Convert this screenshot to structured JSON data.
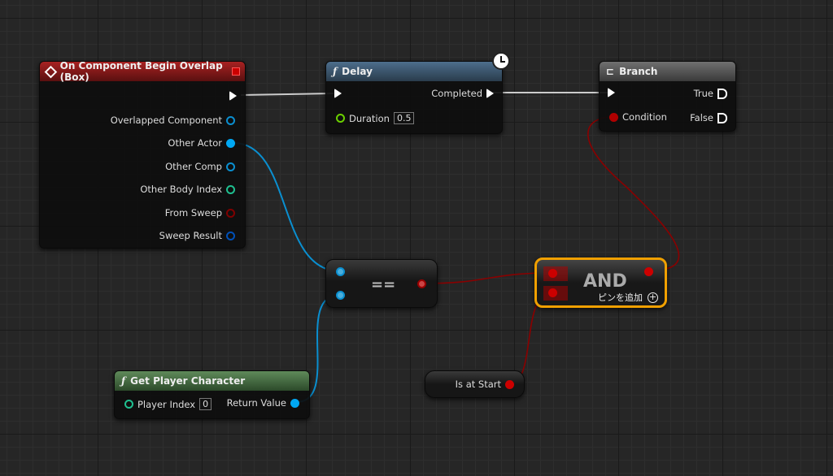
{
  "colors": {
    "event_header": "#8b1a1a",
    "function_header": "#3b5770",
    "branch_header": "#5a5a5a",
    "pure_header": "#4a7048",
    "object_pin": "#00a8f4",
    "int_pin": "#1fe0a0",
    "bool_pin": "#950000",
    "struct_pin": "#0058c8",
    "and_border": "#f0a000"
  },
  "event_node": {
    "title": "On Component Begin Overlap (Box)",
    "icon": "event-diamond-icon",
    "pins": [
      "Overlapped Component",
      "Other Actor",
      "Other Comp",
      "Other Body Index",
      "From Sweep",
      "Sweep Result"
    ]
  },
  "delay_node": {
    "title": "Delay",
    "icon": "function-icon",
    "completed": "Completed",
    "duration_label": "Duration",
    "duration_value": "0.5",
    "latent_icon": "clock-icon"
  },
  "branch_node": {
    "title": "Branch",
    "icon": "branch-icon",
    "true_label": "True",
    "condition_label": "Condition",
    "false_label": "False"
  },
  "equal_node": {
    "label": "=="
  },
  "and_node": {
    "label": "AND",
    "add_pin": "ピンを追加",
    "add_icon": "plus-circle-icon"
  },
  "get_player_node": {
    "title": "Get Player Character",
    "icon": "function-icon",
    "player_index_label": "Player Index",
    "player_index_value": "0",
    "return_label": "Return Value"
  },
  "is_at_start_node": {
    "label": "Is at Start"
  }
}
